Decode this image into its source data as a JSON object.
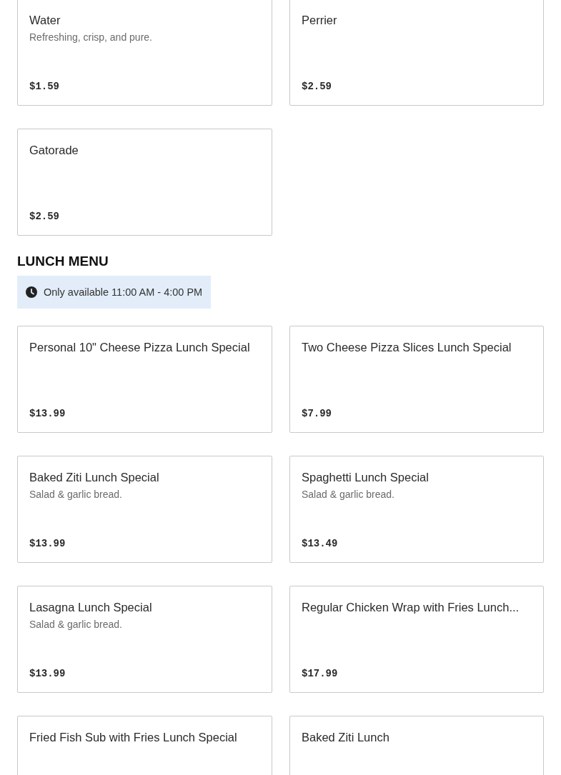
{
  "drinks": [
    {
      "name": "Water",
      "description": "Refreshing, crisp, and pure.",
      "price": "$1.59"
    },
    {
      "name": "Perrier",
      "price": "$2.59"
    },
    {
      "name": "Gatorade",
      "price": "$2.59"
    }
  ],
  "lunch_menu": {
    "title": "LUNCH MENU",
    "availability": "Only available 11:00 AM - 4:00 PM",
    "items": [
      {
        "name": "Personal 10\" Cheese Pizza Lunch Special",
        "price": "$13.99"
      },
      {
        "name": "Two Cheese Pizza Slices Lunch Special",
        "price": "$7.99"
      },
      {
        "name": "Baked Ziti Lunch Special",
        "description": "Salad & garlic bread.",
        "price": "$13.99"
      },
      {
        "name": "Spaghetti Lunch Special",
        "description": "Salad & garlic bread.",
        "price": "$13.49"
      },
      {
        "name": "Lasagna Lunch Special",
        "description": "Salad & garlic bread.",
        "price": "$13.99"
      },
      {
        "name": "Regular Chicken Wrap with Fries Lunch...",
        "price": "$17.99"
      },
      {
        "name": "Fried Fish Sub with Fries Lunch Special"
      },
      {
        "name": "Baked Ziti Lunch"
      }
    ]
  }
}
